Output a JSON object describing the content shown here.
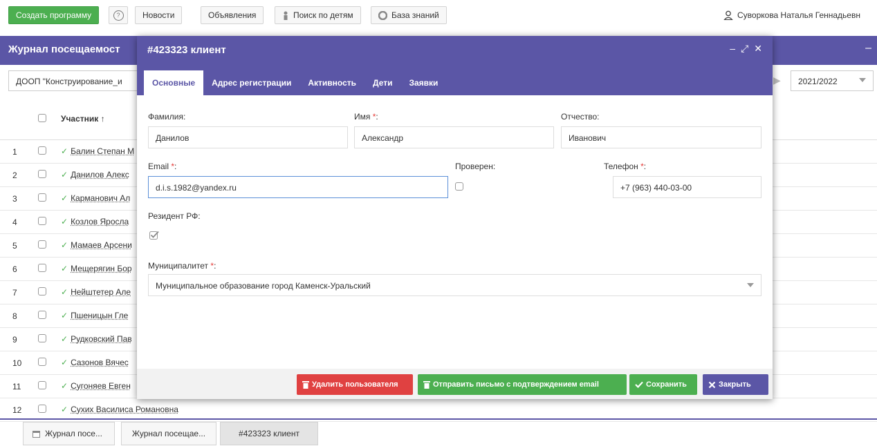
{
  "topbar": {
    "create_program": "Создать программу",
    "help": "?",
    "news": "Новости",
    "announcements": "Объявления",
    "child_search": "Поиск по детям",
    "knowledge_base": "База знаний",
    "user": "Суворкова Наталья Геннадьевн"
  },
  "background": {
    "title": "Журнал посещаемост",
    "filter": "ДООП \"Конструирование_и",
    "year": "2021/2022",
    "column": "Участник ↑",
    "rows": [
      {
        "num": "1",
        "name": "Балин Степан М"
      },
      {
        "num": "2",
        "name": "Данилов Алекс"
      },
      {
        "num": "3",
        "name": "Карманович Ал"
      },
      {
        "num": "4",
        "name": "Козлов Яросла"
      },
      {
        "num": "5",
        "name": "Мамаев Арсени"
      },
      {
        "num": "6",
        "name": "Мещерягин Бор"
      },
      {
        "num": "7",
        "name": "Нейштетер Але"
      },
      {
        "num": "8",
        "name": "Пшеницын Гле"
      },
      {
        "num": "9",
        "name": "Рудковский Пав"
      },
      {
        "num": "10",
        "name": "Сазонов Вячес"
      },
      {
        "num": "11",
        "name": "Сугоняев Евген"
      },
      {
        "num": "12",
        "name": "Сухих Василиса Романовна"
      }
    ]
  },
  "modal": {
    "title": "#423323 клиент",
    "tabs": [
      "Основные",
      "Адрес регистрации",
      "Активность",
      "Дети",
      "Заявки"
    ],
    "fields": {
      "surname_label": "Фамилия:",
      "surname": "Данилов",
      "name_label": "Имя",
      "name": "Александр",
      "patronymic_label": "Отчество:",
      "patronymic": "Иванович",
      "email_label": "Email",
      "email": "d.i.s.1982@yandex.ru",
      "verified_label": "Проверен:",
      "phone_label": "Телефон",
      "phone": "+7 (963) 440-03-00",
      "resident_label": "Резидент РФ:",
      "municipality_label": "Муниципалитет",
      "municipality": "Муниципальное образование город Каменск-Уральский"
    },
    "required_mark": "*",
    "buttons": {
      "delete": "Удалить пользователя",
      "send_email": "Отправить письмо с подтверждением email",
      "save": "Сохранить",
      "close": "Закрыть"
    }
  },
  "taskbar": [
    "Журнал посе...",
    "Журнал посещае...",
    "#423323 клиент"
  ],
  "colors": {
    "header": "#5b56a6",
    "green": "#4caf50",
    "red": "#e04141"
  }
}
